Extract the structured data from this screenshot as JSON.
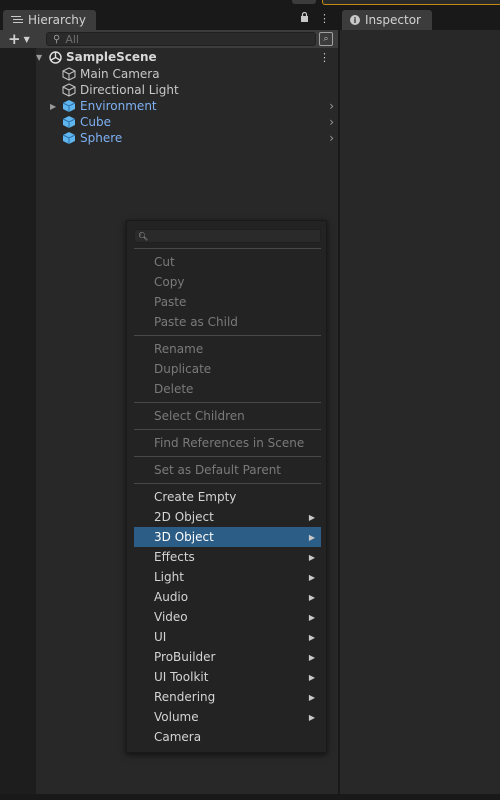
{
  "hierarchy": {
    "tab_label": "Hierarchy",
    "search_placeholder": "All",
    "scene_name": "SampleScene",
    "items": [
      {
        "label": "Main Camera"
      },
      {
        "label": "Directional Light"
      },
      {
        "label": "Environment"
      },
      {
        "label": "Cube"
      },
      {
        "label": "Sphere"
      }
    ]
  },
  "inspector": {
    "tab_label": "Inspector"
  },
  "context_menu": {
    "items": [
      {
        "label": "Cut"
      },
      {
        "label": "Copy"
      },
      {
        "label": "Paste"
      },
      {
        "label": "Paste as Child"
      },
      {
        "label": "Rename"
      },
      {
        "label": "Duplicate"
      },
      {
        "label": "Delete"
      },
      {
        "label": "Select Children"
      },
      {
        "label": "Find References in Scene"
      },
      {
        "label": "Set as Default Parent"
      },
      {
        "label": "Create Empty"
      },
      {
        "label": "2D Object"
      },
      {
        "label": "3D Object"
      },
      {
        "label": "Effects"
      },
      {
        "label": "Light"
      },
      {
        "label": "Audio"
      },
      {
        "label": "Video"
      },
      {
        "label": "UI"
      },
      {
        "label": "ProBuilder"
      },
      {
        "label": "UI Toolkit"
      },
      {
        "label": "Rendering"
      },
      {
        "label": "Volume"
      },
      {
        "label": "Camera"
      }
    ]
  },
  "colors": {
    "selection": "#2c5d87",
    "prefab_text": "#7fb1f2",
    "prefab_icon": "#5fb6ef"
  }
}
